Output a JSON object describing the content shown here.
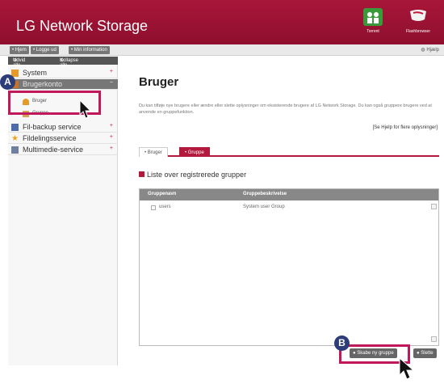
{
  "app": {
    "title": "LG Network Storage"
  },
  "header": {
    "torrent_label": "Torrent",
    "flashbrowser_label": "Flashbrowser",
    "colors": {
      "header_bg": "#9a1234",
      "accent": "#b3193c"
    }
  },
  "toolbar": {
    "home": "• Hjem",
    "logout": "• Logge ud",
    "my_info": "• Min information",
    "help": "Hjælp"
  },
  "sidebar": {
    "expand_all": "Udvid alle",
    "collapse_all": "Kollapse alle",
    "items": [
      {
        "label": "System",
        "icon": "system-icon"
      },
      {
        "label": "Brugerkonto",
        "icon": "user-account-icon"
      },
      {
        "label": "Fil-backup service",
        "icon": "backup-icon"
      },
      {
        "label": "Fildelingsservice",
        "icon": "star-icon"
      },
      {
        "label": "Multimedie-service",
        "icon": "multimedia-icon"
      }
    ],
    "sub_items": [
      {
        "label": "Bruger",
        "icon": "user-icon"
      },
      {
        "label": "Gruppe",
        "icon": "group-icon"
      }
    ]
  },
  "main": {
    "title": "Bruger",
    "description": "Du kan tilføje nye brugere eller ændre eller slette oplysninger om eksisterende brugere af LG Network Storage. Du kan også gruppere brugere ved at anvende en gruppefunktion.",
    "more_link": "[Se Hjelp for flere oplysninger]",
    "tabs": [
      "• Bruger",
      "• Gruppe"
    ],
    "section_title": "Liste over registrerede grupper",
    "table": {
      "headers": [
        "Gruppenavn",
        "Gruppebeskrivelse"
      ],
      "rows": [
        {
          "name": "users",
          "description": "System user Group"
        }
      ]
    },
    "buttons": {
      "create": "● Skabe ny gruppe",
      "delete": "● Slette"
    }
  },
  "annotations": {
    "a": "A",
    "b": "B"
  }
}
